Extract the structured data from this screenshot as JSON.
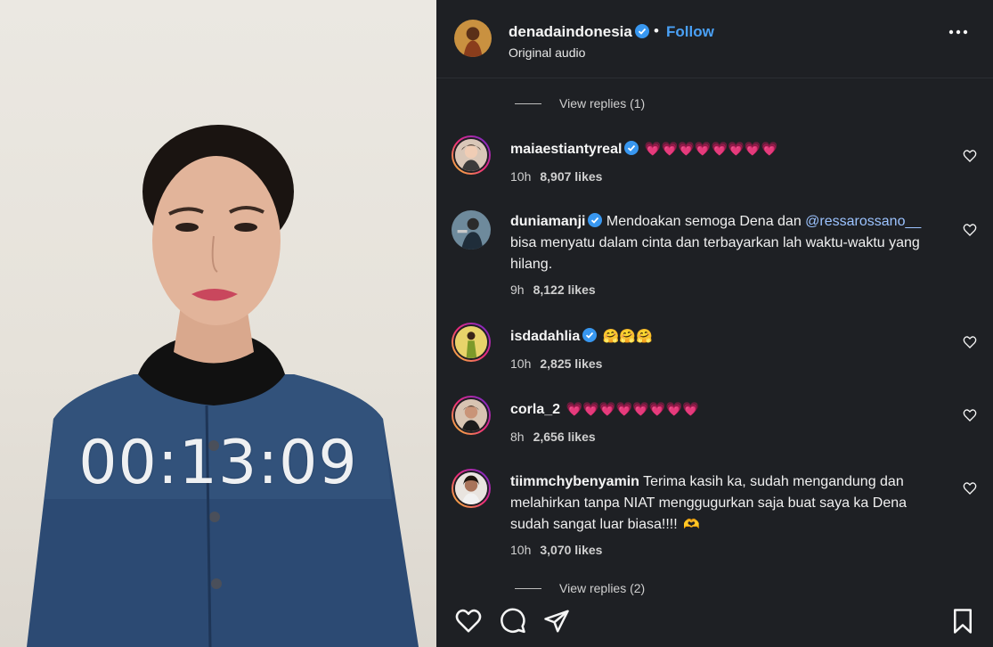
{
  "video": {
    "timer": "00:13:09"
  },
  "header": {
    "username": "denadaindonesia",
    "dot": "•",
    "follow_label": "Follow",
    "audio_label": "Original audio"
  },
  "comments": {
    "view_replies_top": "View replies (1)",
    "view_replies_bottom": "View replies (2)",
    "items": [
      {
        "username": "maiaestiantyreal",
        "verified": true,
        "text": "",
        "emoji": "💗💗💗💗💗💗💗💗",
        "time": "10h",
        "likes": "8,907 likes"
      },
      {
        "username": "duniamanji",
        "verified": true,
        "text_before": "Mendoakan semoga Dena dan ",
        "mention": "@ressarossano__",
        "text_after": " bisa menyatu dalam cinta dan terbayarkan lah waktu-waktu yang hilang.",
        "time": "9h",
        "likes": "8,122 likes"
      },
      {
        "username": "isdadahlia",
        "verified": true,
        "text": "",
        "emoji": "🤗🤗🤗",
        "time": "10h",
        "likes": "2,825 likes"
      },
      {
        "username": "corla_2",
        "verified": false,
        "text": "",
        "emoji": "💗💗💗💗💗💗💗💗",
        "time": "8h",
        "likes": "2,656 likes"
      },
      {
        "username": "tiimmchybenyamin",
        "verified": false,
        "text": "Terima kasih ka, sudah mengandung dan melahirkan tanpa NIAT menggugurkan saja buat saya ka Dena sudah sangat luar biasa!!!! ",
        "emoji": "🫶",
        "time": "10h",
        "likes": "3,070 likes"
      }
    ]
  },
  "colors": {
    "panel_bg": "#1e2024",
    "follow_blue": "#4aa0f5",
    "verified_blue": "#3897f0",
    "heart_pink": "#ee3d6e"
  },
  "icons": {
    "like": "heart-icon",
    "comment": "comment-icon",
    "share": "share-icon",
    "save": "bookmark-icon",
    "more": "more-icon",
    "verified": "verified-badge-icon",
    "comment_like": "heart-outline-icon"
  }
}
